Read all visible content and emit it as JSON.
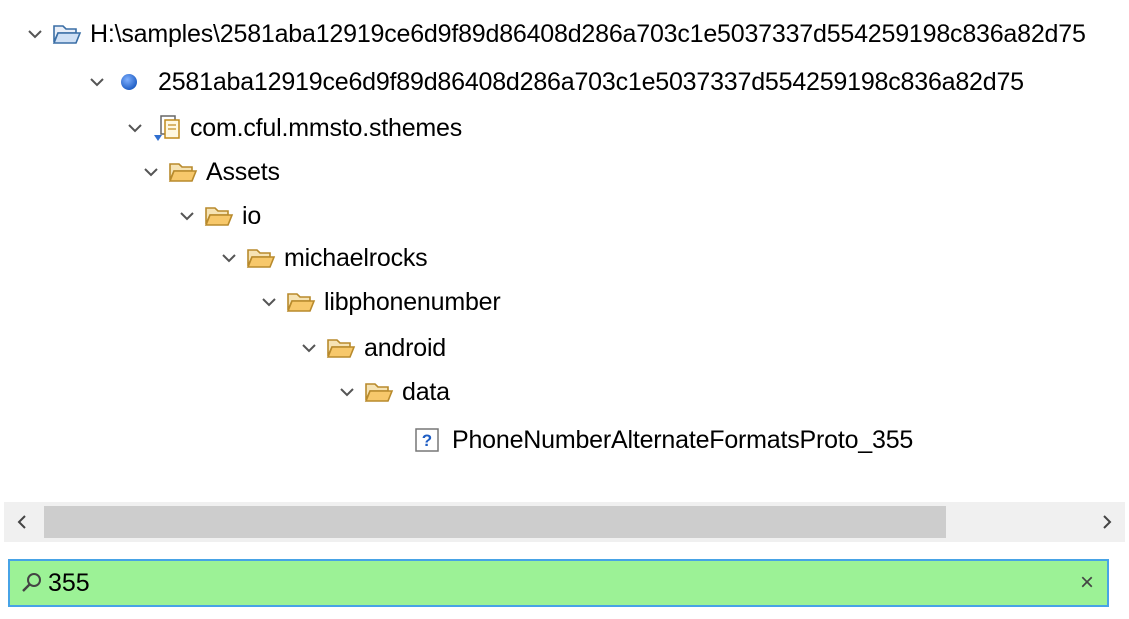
{
  "tree": {
    "items": [
      {
        "label": "H:\\samples\\2581aba12919ce6d9f89d86408d286a703c1e5037337d554259198c836a82d75",
        "icon": "open-folder-icon"
      },
      {
        "label": "2581aba12919ce6d9f89d86408d286a703c1e5037337d554259198c836a82d75",
        "icon": "blue-dot-icon"
      },
      {
        "label": "com.cful.mmsto.sthemes",
        "icon": "package-icon"
      },
      {
        "label": "Assets",
        "icon": "open-folder-icon"
      },
      {
        "label": "io",
        "icon": "open-folder-icon"
      },
      {
        "label": "michaelrocks",
        "icon": "open-folder-icon"
      },
      {
        "label": "libphonenumber",
        "icon": "open-folder-icon"
      },
      {
        "label": "android",
        "icon": "open-folder-icon"
      },
      {
        "label": "data",
        "icon": "open-folder-icon"
      },
      {
        "label": "PhoneNumberAlternateFormatsProto_355",
        "icon": "unknown-file-icon"
      }
    ]
  },
  "scrollbar": {
    "left_arrow": "<",
    "right_arrow": ">"
  },
  "filter": {
    "value": "355",
    "clear_label": "×"
  },
  "colors": {
    "filter_bg": "#9cf296",
    "filter_border": "#47a3e6",
    "folder": "#f7c86b",
    "dot": "#2f6fd0"
  }
}
